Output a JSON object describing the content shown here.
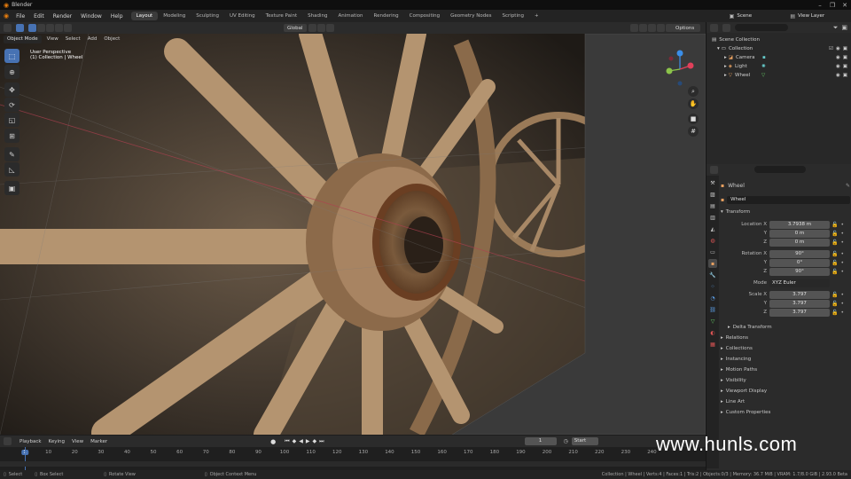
{
  "app": {
    "title": "Blender"
  },
  "menu": [
    "File",
    "Edit",
    "Render",
    "Window",
    "Help"
  ],
  "workspaces": [
    "Layout",
    "Modeling",
    "Sculpting",
    "UV Editing",
    "Texture Paint",
    "Shading",
    "Animation",
    "Rendering",
    "Compositing",
    "Geometry Nodes",
    "Scripting",
    "+"
  ],
  "active_workspace": "Layout",
  "scene": {
    "name": "Scene",
    "view_layer": "View Layer"
  },
  "viewport_header": {
    "mode": "Object Mode",
    "menus": [
      "View",
      "Select",
      "Add",
      "Object"
    ],
    "orientation": "Global",
    "options": "Options"
  },
  "viewport": {
    "perspective_label": "User Perspective",
    "collection_label": "(1) Collection | Wheel"
  },
  "tools": [
    "select-box",
    "cursor",
    "move",
    "rotate",
    "scale",
    "transform",
    "annotate",
    "measure",
    "add-cube"
  ],
  "outliner": {
    "root": "Scene Collection",
    "items": [
      {
        "name": "Collection",
        "indent": 0,
        "icon": "collection-icon"
      },
      {
        "name": "Camera",
        "indent": 1,
        "icon": "camera-icon"
      },
      {
        "name": "Light",
        "indent": 1,
        "icon": "light-icon"
      },
      {
        "name": "Wheel",
        "indent": 1,
        "icon": "mesh-icon"
      }
    ]
  },
  "properties": {
    "object_name": "Wheel",
    "object_data_name": "Wheel",
    "section": "Transform",
    "location": {
      "label": "Location X",
      "x": "3.7938 m",
      "y": "0 m",
      "z": "0 m"
    },
    "rotation": {
      "label": "Rotation X",
      "x": "90°",
      "y": "0°",
      "z": "90°"
    },
    "mode": {
      "label": "Mode",
      "value": "XYZ Euler"
    },
    "scale": {
      "label": "Scale X",
      "x": "3.797",
      "y": "3.797",
      "z": "3.797"
    },
    "axis_y": "Y",
    "axis_z": "Z",
    "panels": [
      "Delta Transform",
      "Relations",
      "Collections",
      "Instancing",
      "Motion Paths",
      "Visibility",
      "Viewport Display",
      "Line Art",
      "Custom Properties"
    ]
  },
  "timeline": {
    "menus": [
      "Playback",
      "Keying",
      "View",
      "Marker"
    ],
    "current_frame": "1",
    "start_label": "Start",
    "frames": [
      "1",
      "10",
      "20",
      "30",
      "40",
      "50",
      "60",
      "70",
      "80",
      "90",
      "100",
      "110",
      "120",
      "130",
      "140",
      "150",
      "160",
      "170",
      "180",
      "190",
      "200",
      "210",
      "220",
      "230",
      "240"
    ]
  },
  "statusbar": {
    "items": [
      "Select",
      "Box Select",
      "Rotate View",
      "Object Context Menu"
    ],
    "stats": "Collection | Wheel | Verts:4 | Faces:1 | Tris:2 | Objects:0/3 | Memory: 36.7 MiB | VRAM: 1.7/8.0 GiB | 2.93.0 Beta"
  },
  "watermark": "www.hunls.com",
  "colors": {
    "accent": "#4772b3",
    "axis_x": "#e0405a",
    "axis_y": "#8bc34a",
    "axis_z": "#3a8ee8"
  }
}
